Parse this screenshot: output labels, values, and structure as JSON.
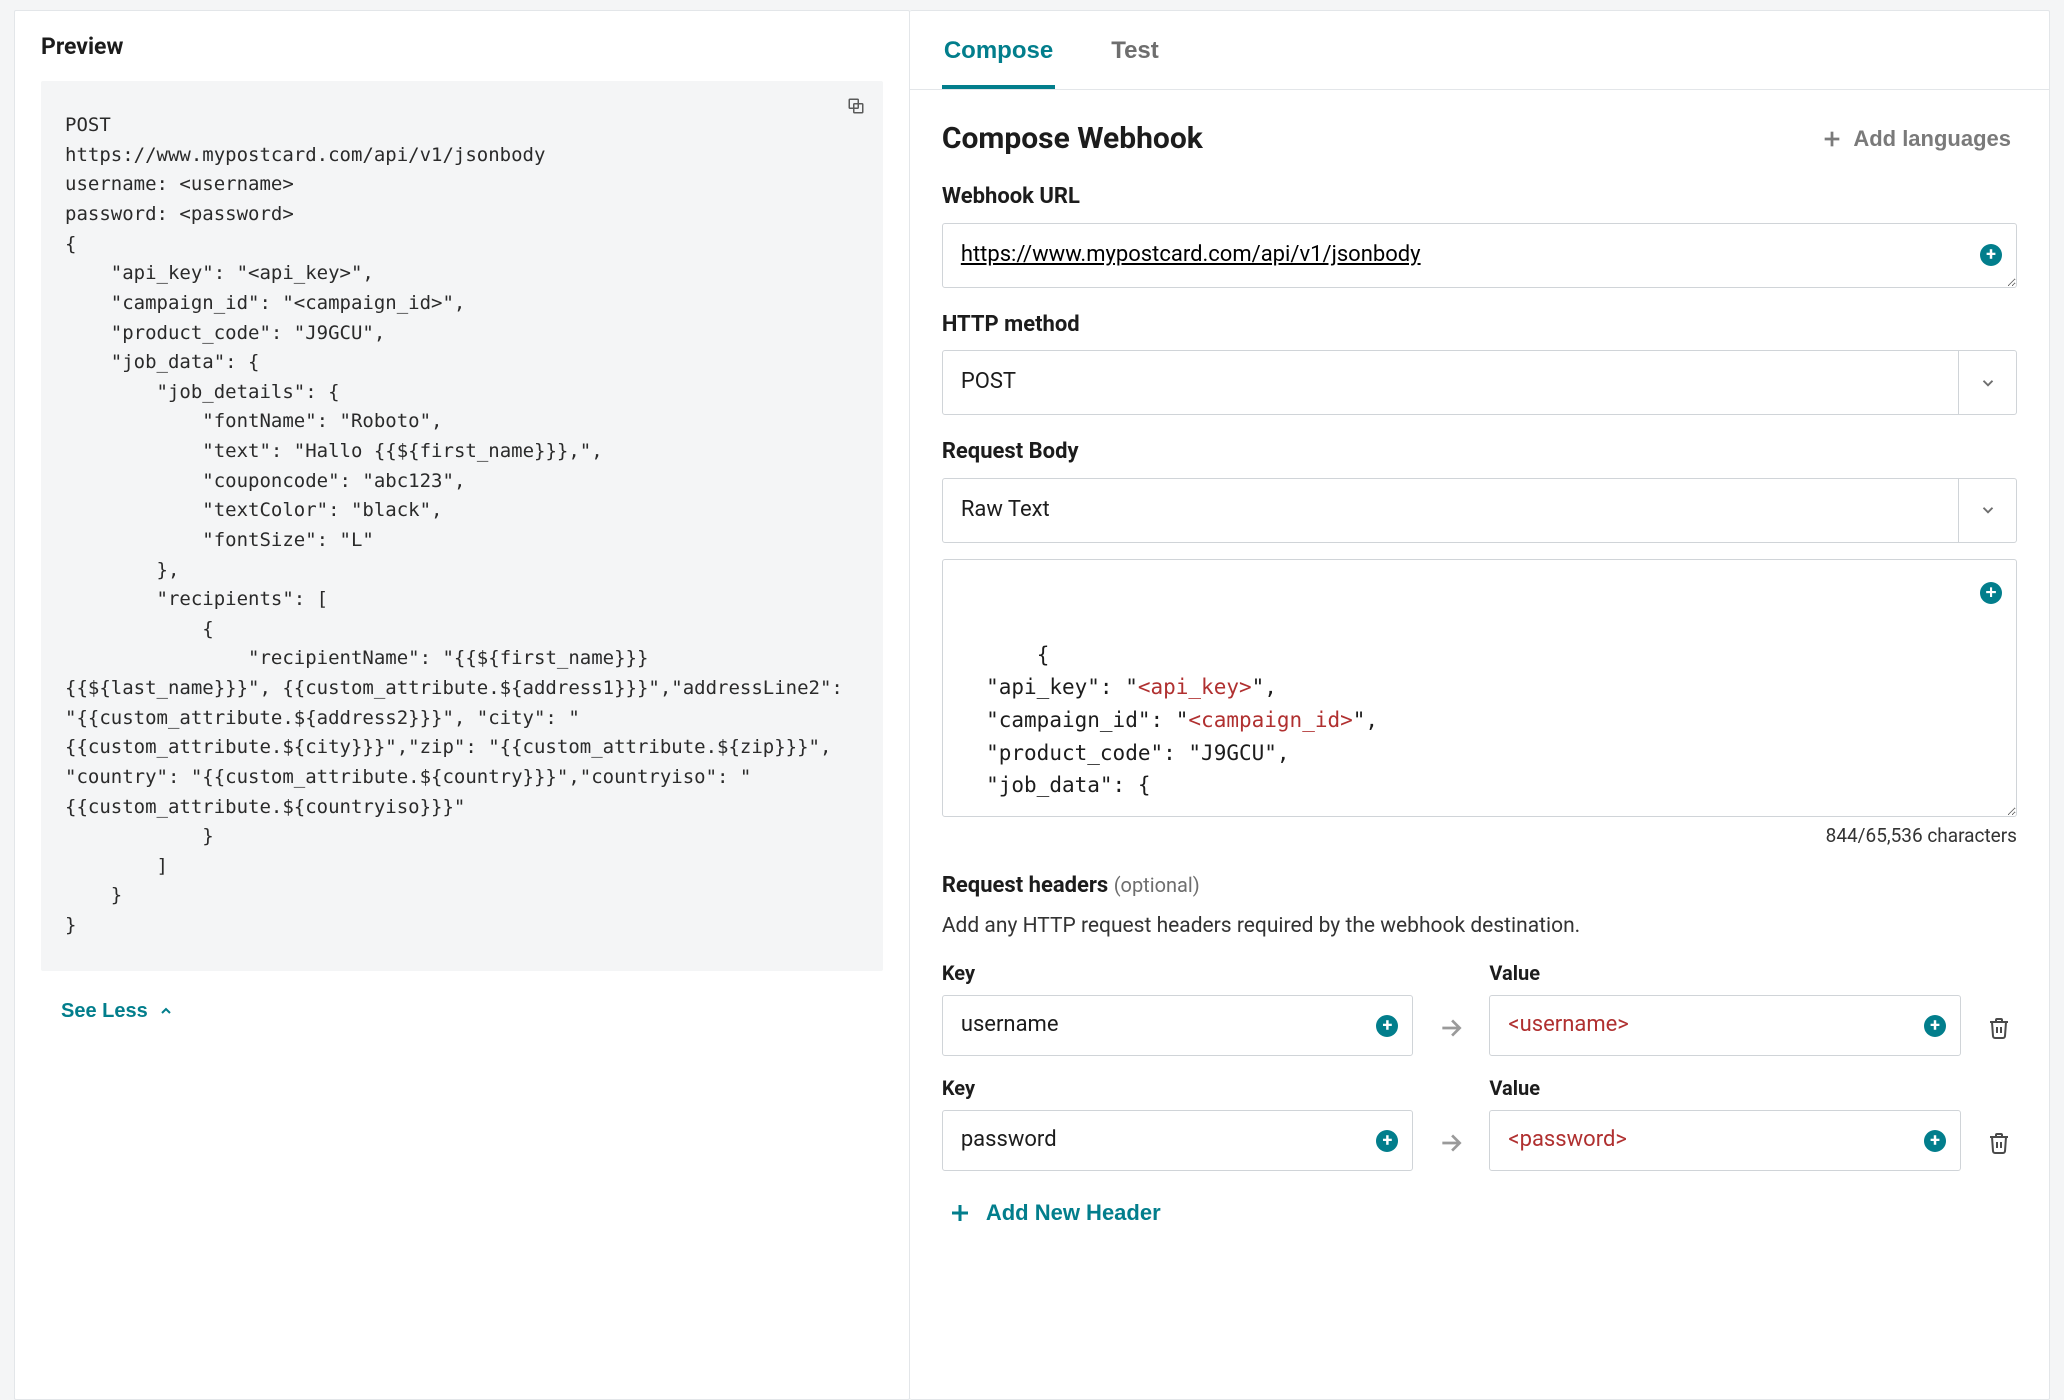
{
  "preview": {
    "title": "Preview",
    "code": "POST\nhttps://www.mypostcard.com/api/v1/jsonbody\nusername: <username>\npassword: <password>\n{\n    \"api_key\": \"<api_key>\",\n    \"campaign_id\": \"<campaign_id>\",\n    \"product_code\": \"J9GCU\",\n    \"job_data\": {\n        \"job_details\": {\n            \"fontName\": \"Roboto\",\n            \"text\": \"Hallo {{${first_name}}},\",\n            \"couponcode\": \"abc123\",\n            \"textColor\": \"black\",\n            \"fontSize\": \"L\"\n        },\n        \"recipients\": [\n            {\n                \"recipientName\": \"{{${first_name}}} {{${last_name}}}\", {{custom_attribute.${address1}}}\",\"addressLine2\": \"{{custom_attribute.${address2}}}\", \"city\": \"{{custom_attribute.${city}}}\",\"zip\": \"{{custom_attribute.${zip}}}\", \"country\": \"{{custom_attribute.${country}}}\",\"countryiso\": \"{{custom_attribute.${countryiso}}}\"\n            }\n        ]\n    }\n}",
    "see_less": "See Less"
  },
  "tabs": {
    "compose": "Compose",
    "test": "Test",
    "active": "compose"
  },
  "compose": {
    "title": "Compose Webhook",
    "add_languages": "Add languages",
    "url_label": "Webhook URL",
    "url_value": "https://www.mypostcard.com/api/v1/jsonbody",
    "method_label": "HTTP method",
    "method_value": "POST",
    "body_label": "Request Body",
    "body_type": "Raw Text",
    "body_segments": [
      {
        "t": "{\n  \"api_key\": \""
      },
      {
        "t": "<api_key>",
        "red": true
      },
      {
        "t": "\",\n  \"campaign_id\": \""
      },
      {
        "t": "<campaign_id>",
        "red": true
      },
      {
        "t": "\",\n  \"product_code\": \"J9GCU\",\n  \"job_data\": {"
      }
    ],
    "char_count": "844/65,536 characters",
    "headers_title": "Request headers",
    "headers_optional": "(optional)",
    "headers_helper": "Add any HTTP request headers required by the webhook destination.",
    "key_label": "Key",
    "value_label": "Value",
    "headers": [
      {
        "key": "username",
        "value": "<username>",
        "value_red": true
      },
      {
        "key": "password",
        "value": "<password>",
        "value_red": true
      }
    ],
    "add_header": "Add New Header"
  }
}
